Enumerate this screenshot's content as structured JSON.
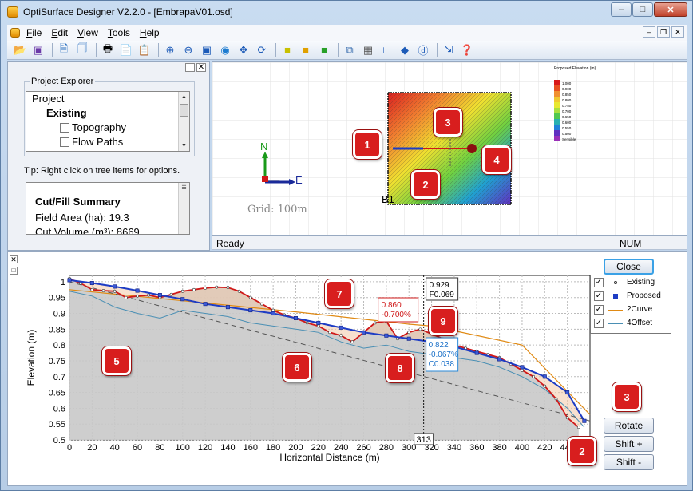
{
  "window": {
    "title": "OptiSurface Designer V2.2.0 - [EmbrapaV01.osd]"
  },
  "menu": [
    {
      "label": "File",
      "key": "F"
    },
    {
      "label": "Edit",
      "key": "E"
    },
    {
      "label": "View",
      "key": "V"
    },
    {
      "label": "Tools",
      "key": "T"
    },
    {
      "label": "Help",
      "key": "H"
    }
  ],
  "explorer": {
    "group": "Project Explorer",
    "tree": {
      "root": "Project",
      "child": "Existing",
      "items": [
        "Topography",
        "Flow Paths"
      ]
    },
    "tip": "Tip: Right click on tree items for options."
  },
  "summary": {
    "title": "Cut/Fill Summary",
    "field_area": "Field Area (ha): 19.3",
    "cut_volume": "Cut Volume (m³): 8669"
  },
  "map": {
    "grid": "Grid: 100m",
    "north": "N",
    "east": "E",
    "point_label": "B1",
    "legend_title": "Proposed Elevation (m)",
    "legend_values": [
      "1.000",
      "0.900",
      "0.850",
      "0.800",
      "0.750",
      "0.700",
      "0.650",
      "0.600",
      "0.550",
      "0.500",
      "Sensible"
    ]
  },
  "status": {
    "text": "Ready",
    "num": "NUM"
  },
  "chart_data": {
    "type": "line",
    "ylabel": "Elevation (m)",
    "xlabel": "Horizontal Distance (m)",
    "xlim": [
      0,
      460
    ],
    "ylim": [
      0.5,
      1.02
    ],
    "xticks": [
      0,
      20,
      40,
      60,
      80,
      100,
      120,
      140,
      160,
      180,
      200,
      220,
      240,
      260,
      280,
      300,
      320,
      340,
      360,
      380,
      400,
      420,
      440
    ],
    "yticks": [
      0.5,
      0.55,
      0.6,
      0.65,
      0.7,
      0.75,
      0.8,
      0.85,
      0.9,
      0.95,
      1
    ],
    "cursor_x": 313,
    "cursor_readout": [
      "0.929",
      "F0.069"
    ],
    "hover_proposed": [
      "0.860",
      "-0.700%"
    ],
    "hover_existing": [
      "0.822",
      "-0.067%",
      "C0.038"
    ],
    "series": [
      {
        "name": "Existing",
        "x": [
          0,
          10,
          20,
          30,
          40,
          50,
          60,
          70,
          80,
          90,
          100,
          110,
          120,
          130,
          140,
          150,
          160,
          170,
          180,
          190,
          200,
          210,
          220,
          230,
          240,
          250,
          260,
          270,
          280,
          290,
          300,
          310,
          320,
          330,
          340,
          350,
          360,
          370,
          380,
          390,
          400,
          410,
          420,
          430,
          440,
          450
        ],
        "values": [
          1.01,
          0.995,
          0.975,
          0.972,
          0.97,
          0.95,
          0.955,
          0.958,
          0.95,
          0.96,
          0.97,
          0.975,
          0.98,
          0.983,
          0.982,
          0.97,
          0.95,
          0.93,
          0.91,
          0.895,
          0.885,
          0.87,
          0.86,
          0.84,
          0.83,
          0.81,
          0.84,
          0.87,
          0.875,
          0.82,
          0.84,
          0.85,
          0.835,
          0.82,
          0.8,
          0.79,
          0.78,
          0.77,
          0.76,
          0.74,
          0.72,
          0.7,
          0.67,
          0.63,
          0.57,
          0.54
        ]
      },
      {
        "name": "Proposed",
        "x": [
          0,
          20,
          40,
          60,
          80,
          100,
          120,
          140,
          160,
          180,
          200,
          220,
          240,
          260,
          280,
          300,
          320,
          340,
          360,
          380,
          400,
          420,
          440,
          455
        ],
        "values": [
          1.005,
          0.996,
          0.985,
          0.972,
          0.958,
          0.945,
          0.93,
          0.92,
          0.91,
          0.9,
          0.885,
          0.87,
          0.855,
          0.84,
          0.83,
          0.82,
          0.81,
          0.795,
          0.775,
          0.755,
          0.73,
          0.7,
          0.65,
          0.56
        ]
      },
      {
        "name": "2Curve",
        "x": [
          0,
          100,
          200,
          300,
          320,
          400,
          460
        ],
        "values": [
          0.975,
          0.94,
          0.905,
          0.866,
          0.86,
          0.8,
          0.58
        ]
      },
      {
        "name": "4Offset",
        "x": [
          0,
          20,
          40,
          60,
          80,
          100,
          120,
          140,
          160,
          180,
          200,
          220,
          240,
          260,
          280,
          300,
          320,
          340,
          360,
          380,
          400,
          420,
          440,
          455
        ],
        "values": [
          0.97,
          0.955,
          0.92,
          0.9,
          0.885,
          0.91,
          0.9,
          0.89,
          0.87,
          0.86,
          0.85,
          0.84,
          0.81,
          0.79,
          0.8,
          0.78,
          0.77,
          0.76,
          0.75,
          0.73,
          0.7,
          0.66,
          0.6,
          0.54
        ]
      }
    ]
  },
  "buttons": {
    "close": "Close",
    "rotate": "Rotate",
    "shift_up": "Shift +",
    "shift_down": "Shift -"
  },
  "badges": [
    "1",
    "2",
    "3",
    "4",
    "5",
    "6",
    "7",
    "8",
    "9",
    "2",
    "3"
  ],
  "colors": {
    "existing": "#d01818",
    "proposed": "#1d3cc4",
    "curve": "#e08a14",
    "offset": "#4a8fb4"
  }
}
